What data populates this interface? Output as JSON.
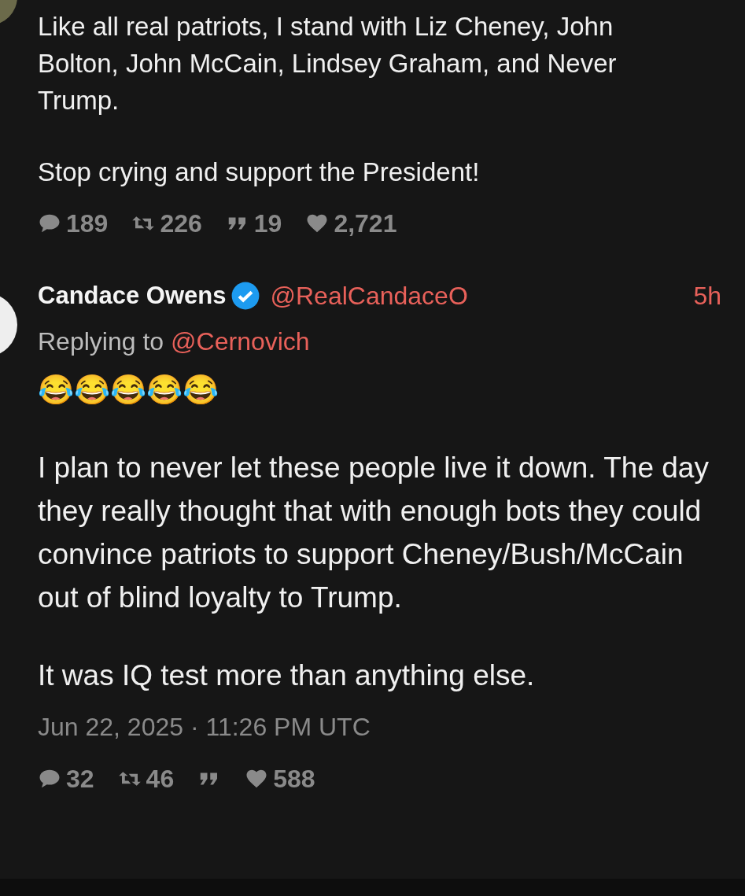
{
  "tweets": [
    {
      "body": [
        "Like all real patriots, I stand with Liz Cheney, John Bolton, John McCain, Lindsey Graham, and Never Trump.",
        "Stop crying and support the President!"
      ],
      "stats": [
        {
          "kind": "reply",
          "count": "189"
        },
        {
          "kind": "retweet",
          "count": "226"
        },
        {
          "kind": "quote",
          "count": "19"
        },
        {
          "kind": "like",
          "count": "2,721"
        }
      ]
    },
    {
      "author": {
        "name": "Candace Owens",
        "verified": true,
        "handle": "@RealCandaceO"
      },
      "time": "5h",
      "replying_to": {
        "label": "Replying to",
        "handle": "@Cernovich"
      },
      "body": [
        "😂😂😂😂😂",
        "I plan to never let these people live it down. The day they really thought that with enough bots they could convince patriots to support Cheney/Bush/McCain out of blind loyalty to Trump.",
        "It was IQ test more than anything else."
      ],
      "date": "Jun 22, 2025 · 11:26 PM UTC",
      "stats": [
        {
          "kind": "reply",
          "count": "32"
        },
        {
          "kind": "retweet",
          "count": "46"
        },
        {
          "kind": "quote"
        },
        {
          "kind": "like",
          "count": "588"
        }
      ]
    }
  ]
}
